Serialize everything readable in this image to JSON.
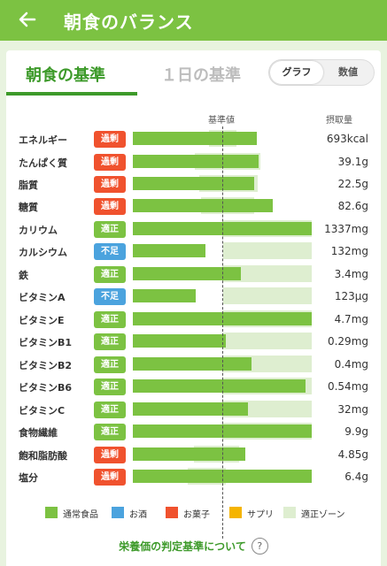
{
  "header": {
    "title": "朝食のバランス",
    "back_icon": "arrow-left-icon"
  },
  "tabs": [
    {
      "label": "朝食の基準",
      "active": true
    },
    {
      "label": "１日の基準",
      "active": false
    }
  ],
  "view_toggle": [
    {
      "label": "グラフ",
      "selected": true
    },
    {
      "label": "数値",
      "selected": false
    }
  ],
  "columns": {
    "standard": "基準値",
    "intake": "摂取量"
  },
  "status_colors": {
    "過剰": "#f0522e",
    "適正": "#7cc242",
    "不足": "#4ba3de"
  },
  "nutrients": [
    {
      "name": "エネルギー",
      "status": "過剰",
      "amount": "693kcal"
    },
    {
      "name": "たんぱく質",
      "status": "過剰",
      "amount": "39.1g"
    },
    {
      "name": "脂質",
      "status": "過剰",
      "amount": "22.5g"
    },
    {
      "name": "糖質",
      "status": "過剰",
      "amount": "82.6g"
    },
    {
      "name": "カリウム",
      "status": "適正",
      "amount": "1337mg"
    },
    {
      "name": "カルシウム",
      "status": "不足",
      "amount": "132mg"
    },
    {
      "name": "鉄",
      "status": "適正",
      "amount": "3.4mg"
    },
    {
      "name": "ビタミンA",
      "status": "不足",
      "amount": "123μg"
    },
    {
      "name": "ビタミンE",
      "status": "適正",
      "amount": "4.7mg"
    },
    {
      "name": "ビタミンB1",
      "status": "適正",
      "amount": "0.29mg"
    },
    {
      "name": "ビタミンB2",
      "status": "適正",
      "amount": "0.4mg"
    },
    {
      "name": "ビタミンB6",
      "status": "適正",
      "amount": "0.54mg"
    },
    {
      "name": "ビタミンC",
      "status": "適正",
      "amount": "32mg"
    },
    {
      "name": "食物繊維",
      "status": "適正",
      "amount": "9.9g"
    },
    {
      "name": "飽和脂肪酸",
      "status": "過剰",
      "amount": "4.85g"
    },
    {
      "name": "塩分",
      "status": "過剰",
      "amount": "6.4g"
    }
  ],
  "legend": [
    {
      "label": "通常食品",
      "color": "#7cc242"
    },
    {
      "label": "お酒",
      "color": "#4ba3de"
    },
    {
      "label": "お菓子",
      "color": "#f0522e"
    },
    {
      "label": "サプリ",
      "color": "#f5b400"
    },
    {
      "label": "適正ゾーン",
      "color": "#deeed0"
    }
  ],
  "footer": {
    "link": "栄養価の判定基準について",
    "help_icon": "question-circle-icon"
  }
}
